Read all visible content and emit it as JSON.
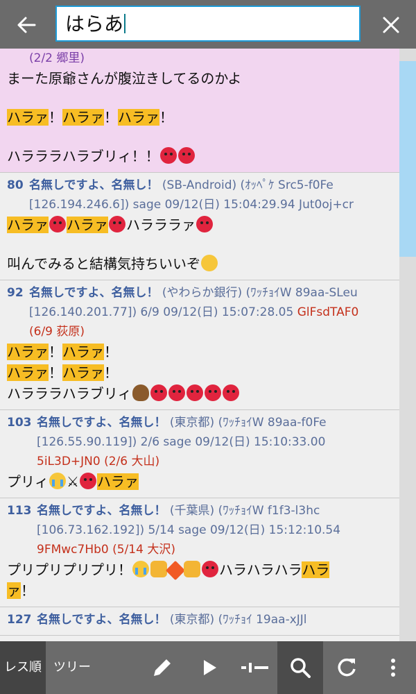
{
  "search": {
    "query": "はらあ"
  },
  "colors": {
    "accent": "#1d9bd7",
    "highlight": "#f7bd24",
    "self_post_bg": "#f2d6f0",
    "id_red": "#c4301b"
  },
  "posts": [
    {
      "partial": true,
      "meta": "(2/2 郷里)",
      "lines": [
        [
          {
            "t": "まーた原爺さんが腹泣きしてるのかよ"
          }
        ],
        [],
        [
          {
            "t": "ハラァ",
            "h": true
          },
          {
            "t": "！"
          },
          {
            "t": "ハラァ",
            "h": true
          },
          {
            "t": "！"
          },
          {
            "t": "ハラァ",
            "h": true
          },
          {
            "t": "！"
          }
        ],
        [],
        [
          {
            "t": "ハラララハラブリィ！！"
          },
          {
            "e": "angry"
          },
          {
            "e": "angry"
          }
        ]
      ]
    },
    {
      "num": "80",
      "name": "名無しですよ、名無し！",
      "info1": "(SB-Android) (ｵｯﾍﾟｹ Src5-f0Fe",
      "info2": "[126.194.246.6]) sage 09/12(日) 15:04:29.94 Jut0oj+cr",
      "lines": [
        [
          {
            "t": "ハラァ",
            "h": true
          },
          {
            "e": "angry"
          },
          {
            "t": "ハラァ",
            "h": true
          },
          {
            "e": "angry"
          },
          {
            "t": "ハラララァ"
          },
          {
            "e": "angry"
          }
        ],
        [],
        [
          {
            "t": "叫んでみると結構気持ちいいぞ"
          },
          {
            "e": "hug"
          }
        ]
      ]
    },
    {
      "num": "92",
      "name": "名無しですよ、名無し！",
      "info1": "(やわらか銀行) (ﾜｯﾁｮｲW 89aa-SLeu",
      "info2": "[126.140.201.77]) 6/9  09/12(日) 15:07:28.05 ",
      "info2_red": "GlFsdTAF0",
      "info3_red": "(6/9 荻原)",
      "lines": [
        [
          {
            "t": "ハラァ",
            "h": true
          },
          {
            "t": "！"
          },
          {
            "t": "ハラァ",
            "h": true
          },
          {
            "t": "！"
          }
        ],
        [
          {
            "t": "ハラァ",
            "h": true
          },
          {
            "t": "！"
          },
          {
            "t": "ハラァ",
            "h": true
          },
          {
            "t": "！"
          }
        ],
        [
          {
            "t": "ハラララハラブリィ"
          },
          {
            "e": "poo"
          },
          {
            "e": "angry"
          },
          {
            "e": "angry"
          },
          {
            "e": "angry"
          },
          {
            "e": "angry"
          },
          {
            "e": "angry"
          }
        ]
      ]
    },
    {
      "num": "103",
      "name": "名無しですよ、名無し！",
      "info1": "(東京都) (ﾜｯﾁｮｲW 89aa-f0Fe",
      "info2": "[126.55.90.119]) 2/6 sage 09/12(日) 15:10:33.00",
      "info3_red": "5iL3D+JN0 (2/6 大山)",
      "lines": [
        [
          {
            "t": "プリィ"
          },
          {
            "e": "cry"
          },
          {
            "t": "⚔"
          },
          {
            "e": "angry"
          },
          {
            "t": "ハラァ",
            "h": true
          }
        ]
      ]
    },
    {
      "num": "113",
      "name": "名無しですよ、名無し！",
      "info1": "(千葉県) (ﾜｯﾁｮｲW f1f3-l3hc",
      "info2": "[106.73.162.192]) 5/14 sage 09/12(日) 15:12:10.54",
      "info3_red": "9FMwc7Hb0 (5/14 大沢)",
      "lines": [
        [
          {
            "t": "プリプリプリプリ！"
          },
          {
            "e": "cry"
          },
          {
            "e": "fist"
          },
          {
            "e": "boom"
          },
          {
            "e": "fist"
          },
          {
            "e": "angry"
          },
          {
            "t": "ハラハラハラ"
          },
          {
            "t": "ハラ",
            "h": true
          }
        ],
        [
          {
            "t": "ァ",
            "h": true
          },
          {
            "t": "！"
          }
        ]
      ]
    },
    {
      "num": "127",
      "name": "名無しですよ、名無し！",
      "info1": "(東京都) (ﾜｯﾁｮｲ 19aa-xJJl",
      "lines": []
    }
  ],
  "bottom_bar": {
    "tab_res": "レス順",
    "tab_tree": "ツリー",
    "icons": [
      "pencil-icon",
      "play-icon",
      "slider-icon",
      "search-icon",
      "refresh-icon",
      "more-icon"
    ]
  }
}
